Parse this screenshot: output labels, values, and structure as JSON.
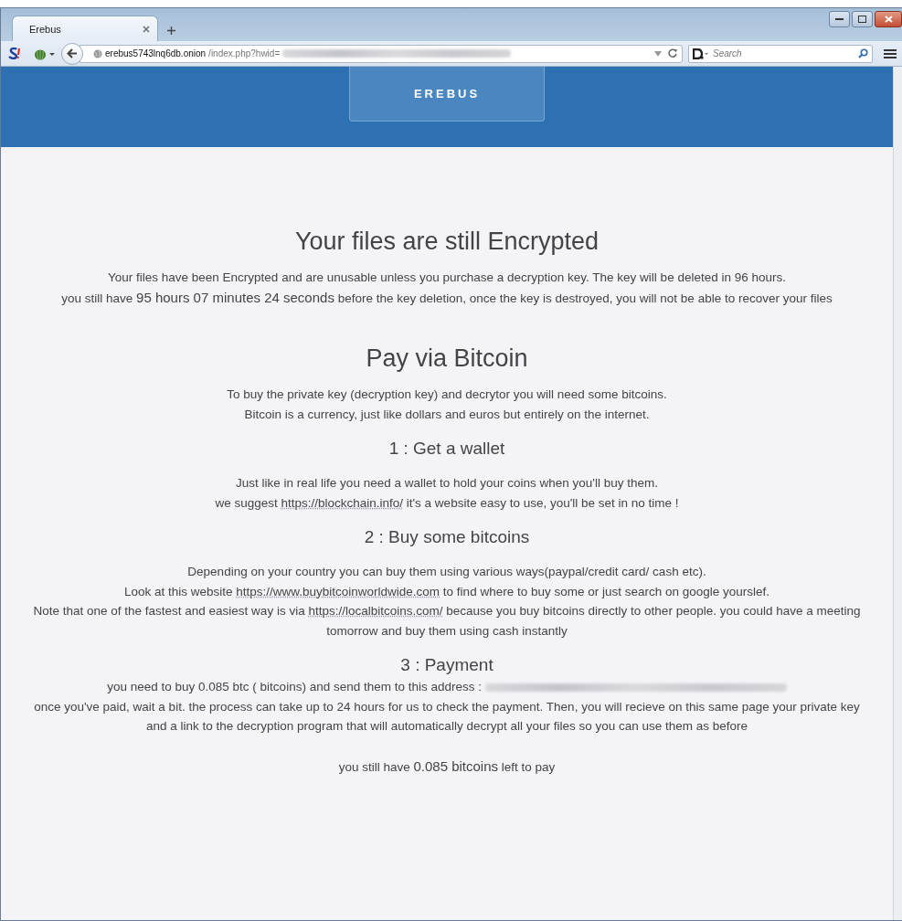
{
  "browser": {
    "tab": {
      "title": "Erebus",
      "selected": true
    },
    "url": {
      "host": "erebus5743lnq6db.onion",
      "path": "/index.php?hwid="
    },
    "search": {
      "placeholder": "Search"
    }
  },
  "page": {
    "brand": "EREBUS",
    "blocks": [
      {
        "kind": "title",
        "text": "Your files are still Encrypted"
      },
      {
        "kind": "text",
        "segments": [
          {
            "kind": "plain",
            "text": "Your files have been Encrypted and are unusable unless you purchase a decryption key. The key will be deleted in 96 hours."
          }
        ]
      },
      {
        "kind": "text",
        "segments": [
          {
            "kind": "plain",
            "text": "you still have "
          },
          {
            "kind": "large",
            "text": "95 hours 07 minutes 24 seconds"
          },
          {
            "kind": "plain",
            "text": " before the key deletion, once the key is destroyed, you will not be able to recover your files"
          }
        ]
      },
      {
        "kind": "title",
        "text": "Pay via Bitcoin"
      },
      {
        "kind": "text",
        "segments": [
          {
            "kind": "plain",
            "text": "To buy the private key (decryption key) and decrytor you will need some bitcoins."
          }
        ]
      },
      {
        "kind": "text",
        "segments": [
          {
            "kind": "plain",
            "text": "Bitcoin is a currency, just like dollars and euros but entirely on the internet."
          }
        ]
      },
      {
        "kind": "heading",
        "text": "1 : Get a wallet"
      },
      {
        "kind": "text",
        "segments": [
          {
            "kind": "plain",
            "text": "Just like in real life you need a wallet to hold your coins when you'll buy them."
          }
        ]
      },
      {
        "kind": "text",
        "segments": [
          {
            "kind": "plain",
            "text": "we suggest "
          },
          {
            "kind": "link",
            "text": "https://blockchain.info/"
          },
          {
            "kind": "plain",
            "text": " it's a website easy to use, you'll be set in no time !"
          }
        ]
      },
      {
        "kind": "heading",
        "text": "2 : Buy some bitcoins"
      },
      {
        "kind": "text",
        "segments": [
          {
            "kind": "plain",
            "text": "Depending on your country you can buy them using various ways(paypal/credit card/ cash etc)."
          }
        ]
      },
      {
        "kind": "text",
        "segments": [
          {
            "kind": "plain",
            "text": "Look at this website "
          },
          {
            "kind": "link",
            "text": "https://www.buybitcoinworldwide.com"
          },
          {
            "kind": "plain",
            "text": " to find where to buy some or just search on google yourslef."
          }
        ]
      },
      {
        "kind": "text",
        "segments": [
          {
            "kind": "plain",
            "text": "Note that one of the fastest and easiest way is via "
          },
          {
            "kind": "link",
            "text": "https://localbitcoins.com/"
          },
          {
            "kind": "plain",
            "text": " because you buy bitcoins directly to other people. you could have a meeting tomorrow and buy them using cash instantly"
          }
        ]
      },
      {
        "kind": "heading",
        "text": "3 : Payment"
      },
      {
        "kind": "text",
        "segments": [
          {
            "kind": "plain",
            "text": "you need to buy 0.085 btc ( bitcoins) and send them to this address : "
          },
          {
            "kind": "redacted"
          }
        ]
      },
      {
        "kind": "text",
        "segments": [
          {
            "kind": "plain",
            "text": "once you've paid, wait a bit. the process can take up to 24 hours for us to check the payment. Then, you will recieve on this same page your private key and a link to the decryption program that will automatically decrypt all your files so you can use them as before"
          }
        ]
      },
      {
        "kind": "gap"
      },
      {
        "kind": "text",
        "segments": [
          {
            "kind": "plain",
            "text": "you still have "
          },
          {
            "kind": "large",
            "text": "0.085 bitcoins"
          },
          {
            "kind": "plain",
            "text": " left to pay"
          }
        ]
      }
    ]
  }
}
